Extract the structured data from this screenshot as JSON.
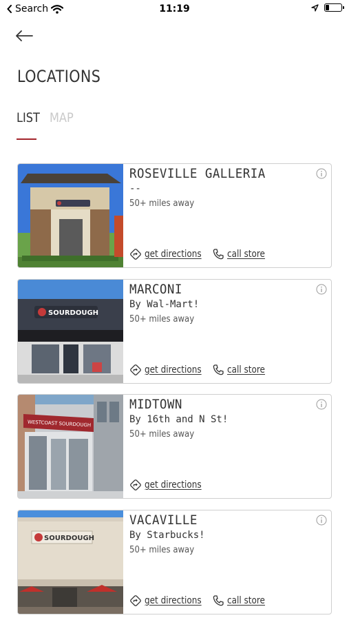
{
  "status_bar": {
    "carrier": "Search",
    "time": "11:19",
    "battery_level": 0.2
  },
  "header": {
    "title": "LOCATIONS"
  },
  "tabs": [
    {
      "label": "LIST",
      "active": true
    },
    {
      "label": "MAP",
      "active": false
    }
  ],
  "colors": {
    "accent": "#a3242b",
    "inactive_tab": "#c9c9c9",
    "card_border": "#cfcfcf"
  },
  "locations": [
    {
      "name": "ROSEVILLE GALLERIA",
      "note": "--",
      "distance": "50+ miles away",
      "directions_label": "get directions",
      "call_label": "call store"
    },
    {
      "name": "MARCONI",
      "note": "By Wal-Mart!",
      "distance": "50+ miles away",
      "directions_label": "get directions",
      "call_label": "call store"
    },
    {
      "name": "MIDTOWN",
      "note": "By 16th and N St!",
      "distance": "50+ miles away",
      "directions_label": "get directions"
    },
    {
      "name": "VACAVILLE",
      "note": "By Starbucks!",
      "distance": "50+ miles away",
      "directions_label": "get directions",
      "call_label": "call store"
    }
  ],
  "icons": {
    "back": "arrow-left-icon",
    "info": "info-icon",
    "directions": "directions-icon",
    "phone": "phone-icon"
  },
  "photo_signs": {
    "marconi": "SOURDOUGH",
    "midtown": "WESTCOAST SOURDOUGH",
    "vacaville": "SOURDOUGH"
  }
}
